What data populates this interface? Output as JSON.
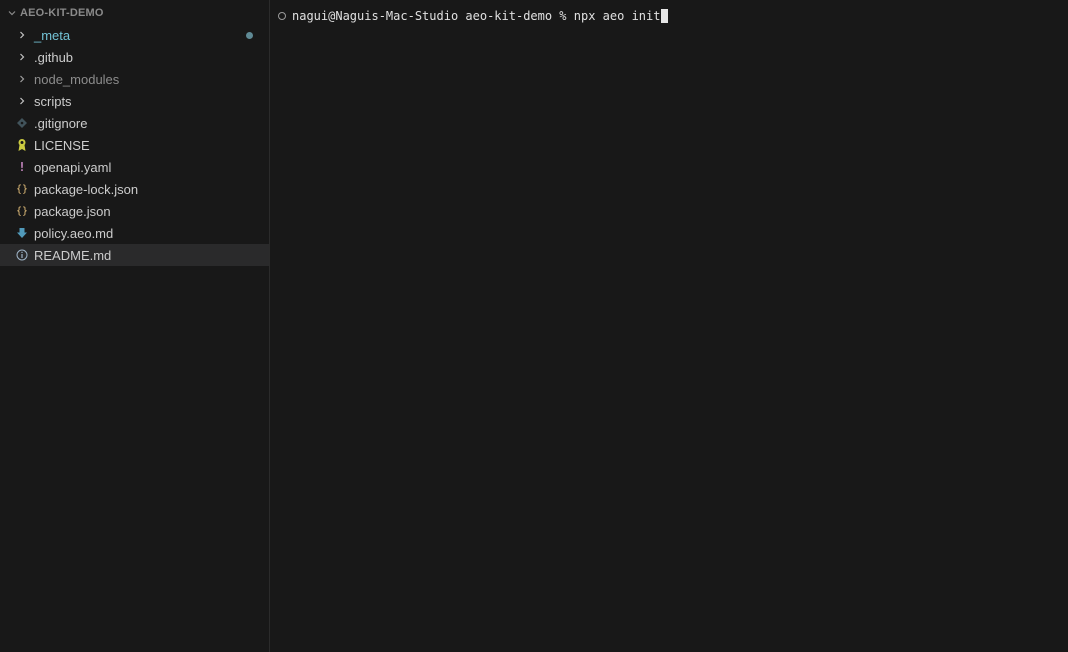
{
  "explorer": {
    "section_title": "AEO-KIT-DEMO",
    "items": [
      {
        "label": "_meta",
        "kind": "folder",
        "modified": true
      },
      {
        "label": ".github",
        "kind": "folder"
      },
      {
        "label": "node_modules",
        "kind": "folder"
      },
      {
        "label": "scripts",
        "kind": "folder"
      },
      {
        "label": ".gitignore",
        "kind": "file",
        "icon": "git-icon"
      },
      {
        "label": "LICENSE",
        "kind": "file",
        "icon": "license-icon"
      },
      {
        "label": "openapi.yaml",
        "kind": "file",
        "icon": "yaml-icon",
        "glyph": "!"
      },
      {
        "label": "package-lock.json",
        "kind": "file",
        "icon": "json-icon",
        "glyph": "{}"
      },
      {
        "label": "package.json",
        "kind": "file",
        "icon": "json-icon",
        "glyph": "{}"
      },
      {
        "label": "policy.aeo.md",
        "kind": "file",
        "icon": "markdown-icon"
      },
      {
        "label": "README.md",
        "kind": "file",
        "icon": "info-icon",
        "selected": true
      }
    ]
  },
  "terminal": {
    "prompt": "nagui@Naguis-Mac-Studio aeo-kit-demo % ",
    "command": "npx aeo init"
  },
  "colors": {
    "background": "#181818",
    "selected_row": "#2a2a2b",
    "meta_folder": "#73c3d6",
    "json_icon": "#e5c07b",
    "yaml_icon": "#c586c0",
    "markdown_icon": "#519aba"
  }
}
